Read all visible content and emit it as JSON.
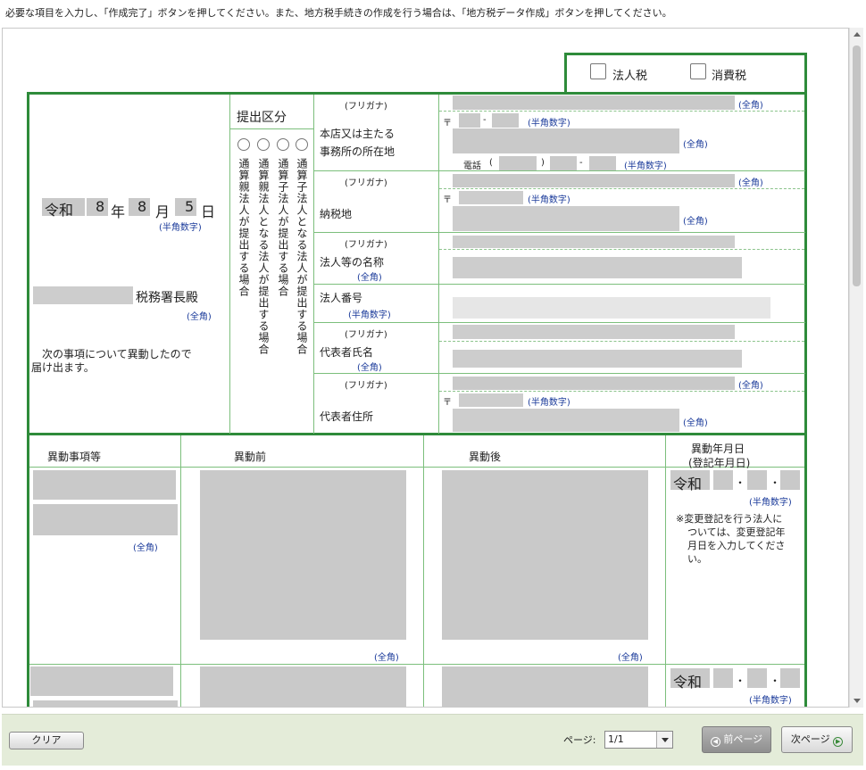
{
  "instruction": "必要な項目を入力し、「作成完了」ボタンを押してください。また、地方税手続きの作成を行う場合は、「地方税データ作成」ボタンを押してください。",
  "tax_types": {
    "corporate": "法人税",
    "consumption": "消費税"
  },
  "date": {
    "era": "令和",
    "year": "8",
    "year_unit": "年",
    "month": "8",
    "month_unit": "月",
    "day": "5",
    "day_unit": "日",
    "hint": "(半角数字)"
  },
  "office": {
    "suffix": "税務署長殿",
    "hint": "(全角)"
  },
  "declaration": [
    "次の事項について異動したので",
    "届け出ます。"
  ],
  "submission": {
    "title": "提出区分",
    "options": [
      "通算親法人が提出する場合",
      "通算親法人となる法人が提出する場合",
      "通算子法人が提出する場合",
      "通算子法人となる法人が提出する場合"
    ]
  },
  "hints": {
    "furigana": "(フリガナ)",
    "zenkaku": "(全角)",
    "hankaku": "(半角数字)"
  },
  "fields": {
    "head_office": [
      "本店又は主たる",
      "事務所の所在地"
    ],
    "postal_mark": "〒",
    "dash": "-",
    "phone_label": "電話",
    "paren_open": "(",
    "paren_close": ")",
    "tax_place": "納税地",
    "corp_name": "法人等の名称",
    "corp_number": "法人番号",
    "rep_name": "代表者氏名",
    "rep_address": "代表者住所"
  },
  "changes": {
    "col_item": "異動事項等",
    "col_before": "異動前",
    "col_after": "異動後",
    "col_date": [
      "異動年月日",
      "(登記年月日)"
    ],
    "era": "令和",
    "dot": "・",
    "note": [
      "※変更登記を行う法人に",
      "ついては、変更登記年",
      "月日を入力してくださ",
      "い。"
    ]
  },
  "footer": {
    "clear": "クリア",
    "page_label": "ページ:",
    "page_value": "1/1",
    "prev": "前ページ",
    "next": "次ページ"
  },
  "colors": {
    "border": "#2e8b3a",
    "footer_bg": "#e4ecd9"
  }
}
